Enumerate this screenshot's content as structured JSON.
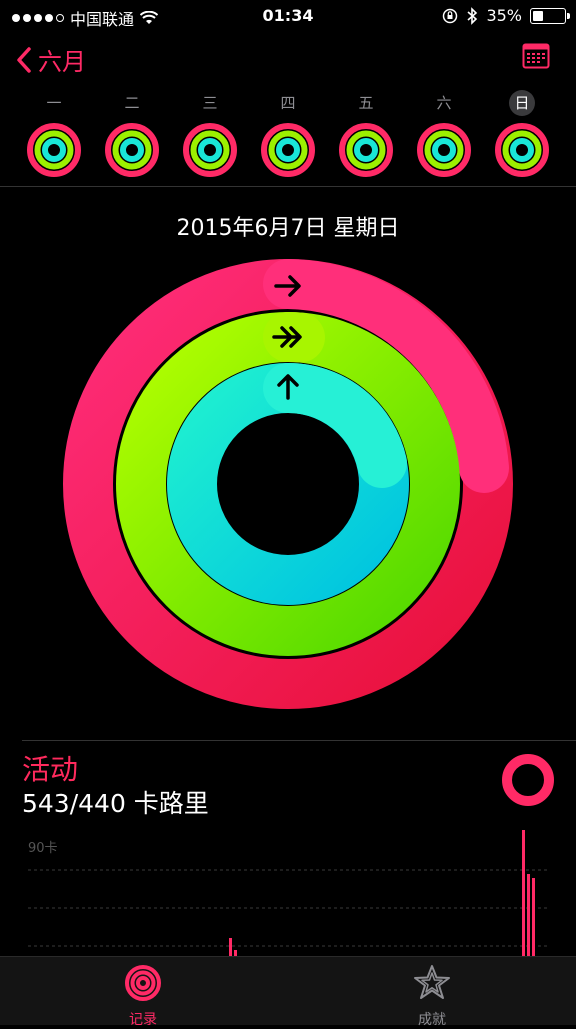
{
  "status": {
    "carrier": "中国联通",
    "time": "01:34",
    "battery": "35%",
    "battery_level": 0.35
  },
  "nav": {
    "back_label": "六月",
    "calendar_icon": "calendar-icon"
  },
  "week": {
    "days": [
      {
        "label": "一",
        "selected": false
      },
      {
        "label": "二",
        "selected": false
      },
      {
        "label": "三",
        "selected": false
      },
      {
        "label": "四",
        "selected": false
      },
      {
        "label": "五",
        "selected": false
      },
      {
        "label": "六",
        "selected": false
      },
      {
        "label": "日",
        "selected": true
      }
    ]
  },
  "date": "2015年6月7日 星期日",
  "rings": {
    "move": {
      "color": "#ff2a66",
      "progress": 1.234
    },
    "exercise": {
      "color": "#9cf000",
      "progress": 1.1
    },
    "stand": {
      "color": "#19e6d7",
      "progress": 0.9
    }
  },
  "activity": {
    "title": "活动",
    "value": "543/440 卡路里"
  },
  "chart": {
    "y_label": "90卡"
  },
  "tabs": [
    {
      "label": "记录",
      "active": true
    },
    {
      "label": "成就",
      "active": false
    }
  ],
  "colors": {
    "accent": "#ff2a66",
    "move": "#ff2a66",
    "exercise": "#9cf000",
    "stand": "#19e6d7"
  }
}
